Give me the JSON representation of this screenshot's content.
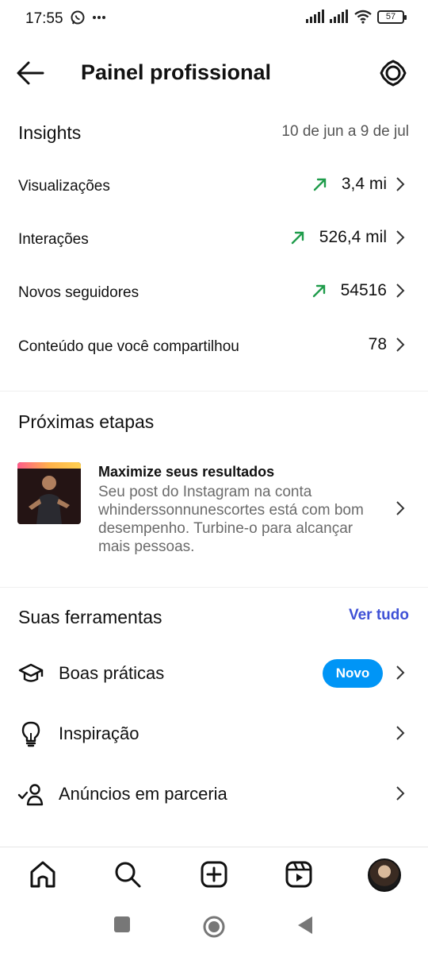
{
  "status_bar": {
    "time": "17:55",
    "battery": "57",
    "icons": [
      "whatsapp-icon",
      "more-dots-icon",
      "signal-icon",
      "signal-icon",
      "wifi-icon",
      "battery-icon"
    ]
  },
  "header": {
    "title": "Painel profissional",
    "back_icon": "arrow-left-icon",
    "settings_icon": "gear-icon"
  },
  "insights": {
    "title": "Insights",
    "date_range": "10 de jun a 9 de jul",
    "metrics": [
      {
        "label": "Visualizações",
        "value": "3,4 mi",
        "trend": "up"
      },
      {
        "label": "Interações",
        "value": "526,4 mil",
        "trend": "up"
      },
      {
        "label": "Novos seguidores",
        "value": "54516",
        "trend": "up"
      },
      {
        "label": "Conteúdo que você compartilhou",
        "value": "78",
        "trend": "none"
      }
    ]
  },
  "next_steps": {
    "title": "Próximas etapas",
    "card": {
      "title": "Maximize seus resultados",
      "body": "Seu post do Instagram na conta whinderssonnunescortes está com bom desempenho. Turbine-o para alcançar mais pessoas."
    }
  },
  "tools": {
    "title": "Suas ferramentas",
    "see_all": "Ver tudo",
    "items": [
      {
        "label": "Boas práticas",
        "badge": "Novo",
        "icon": "graduation-cap-icon"
      },
      {
        "label": "Inspiração",
        "badge": "",
        "icon": "lightbulb-icon"
      },
      {
        "label": "Anúncios em parceria",
        "badge": "",
        "icon": "partner-check-icon"
      }
    ]
  },
  "colors": {
    "accent_link": "#3f51d6",
    "badge": "#0095f6",
    "trend_up": "#1f9c4b",
    "secondary_text": "#6b6b6b"
  },
  "bottom_nav": [
    "home-icon",
    "search-icon",
    "create-icon",
    "reels-icon",
    "profile-avatar"
  ],
  "system_nav": [
    "recents-square",
    "home-circle",
    "back-triangle"
  ]
}
